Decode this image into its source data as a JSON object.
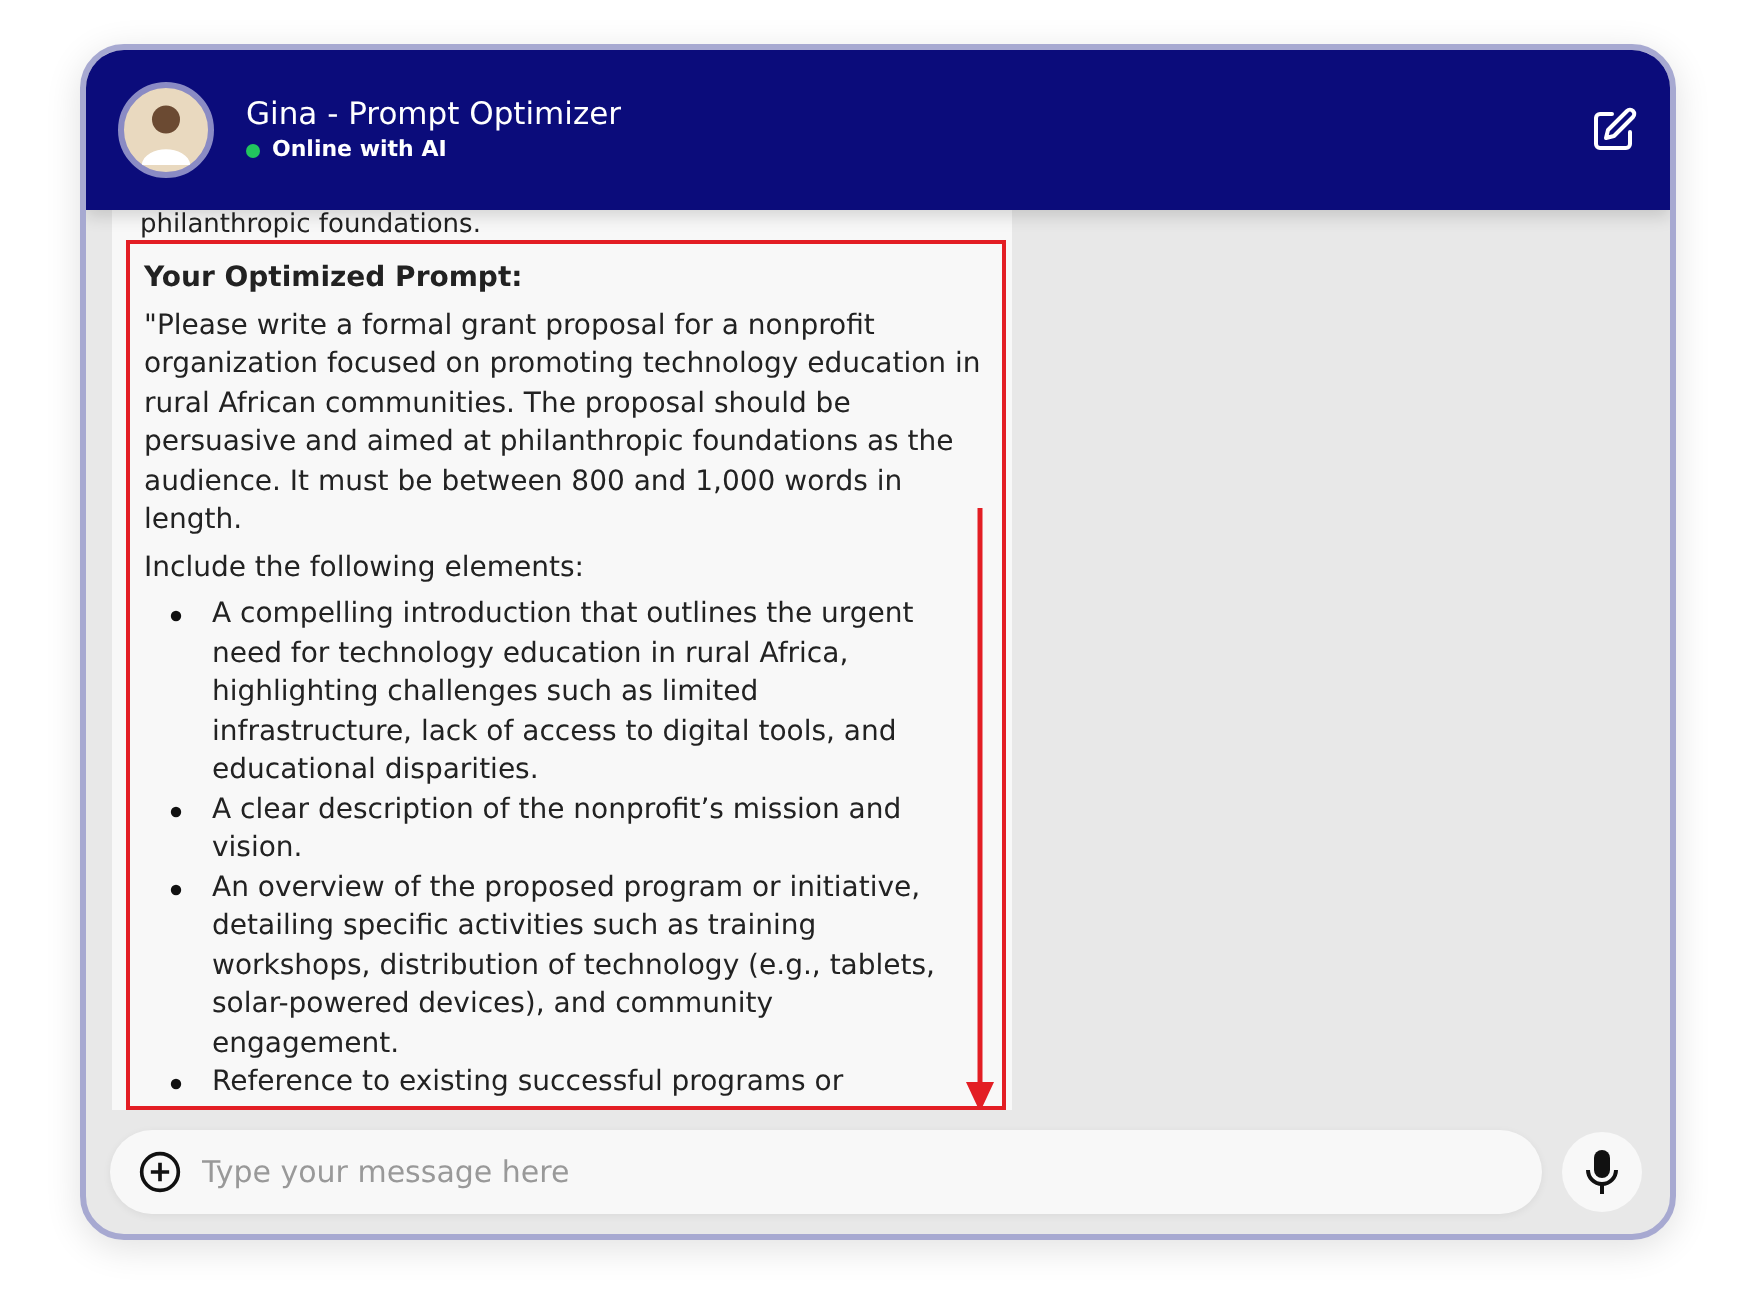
{
  "header": {
    "title": "Gina - Prompt Optimizer",
    "status": {
      "text": "Online with AI",
      "online": true
    }
  },
  "message": {
    "lead_text": "philanthropic foundations.",
    "heading": "Your Optimized Prompt:",
    "paragraphs": [
      "\"Please write a formal grant proposal for a nonprofit organization focused on promoting technology education in rural African communities. The proposal should be persuasive and aimed at philanthropic foundations as the audience. It must be between 800 and 1,000 words in length.",
      "Include the following elements:"
    ],
    "bullets": [
      "A compelling introduction that outlines the urgent need for technology education in rural Africa, highlighting challenges such as limited infrastructure, lack of access to digital tools, and educational disparities.",
      "A clear description of the nonprofit’s mission and vision.",
      "An overview of the proposed program or initiative, detailing specific activities such as training workshops, distribution of technology (e.g., tablets, solar-powered devices), and community engagement.",
      "Reference to existing successful programs or"
    ]
  },
  "composer": {
    "placeholder": "Type your message here"
  }
}
